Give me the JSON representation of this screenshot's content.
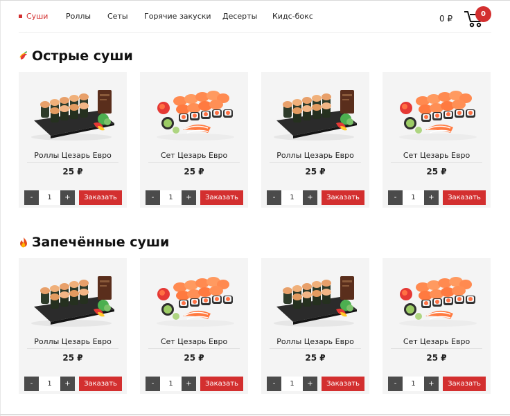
{
  "nav": {
    "items": [
      {
        "label": "Суши",
        "active": true
      },
      {
        "label": "Роллы",
        "active": false
      },
      {
        "label": "Сеты",
        "active": false
      },
      {
        "label": "Горячие закуски",
        "active": false
      },
      {
        "label": "Десерты",
        "active": false
      },
      {
        "label": "Кидс-бокс",
        "active": false
      }
    ]
  },
  "cart": {
    "total": "0 ₽",
    "count": "0",
    "icon": "cart-icon"
  },
  "sections": [
    {
      "title": "Острые суши",
      "icon": "chili-icon",
      "products": [
        {
          "name": "Роллы Цезарь Евро",
          "price": "25 ₽",
          "qty": "1",
          "image": "gunkan-board-image"
        },
        {
          "name": "Сет Цезарь Евро",
          "price": "25 ₽",
          "qty": "1",
          "image": "sushi-set-image"
        },
        {
          "name": "Роллы Цезарь Евро",
          "price": "25 ₽",
          "qty": "1",
          "image": "gunkan-board-image"
        },
        {
          "name": "Сет Цезарь Евро",
          "price": "25 ₽",
          "qty": "1",
          "image": "sushi-set-image"
        }
      ]
    },
    {
      "title": "Запечённые суши",
      "icon": "fire-icon",
      "products": [
        {
          "name": "Роллы Цезарь Евро",
          "price": "25 ₽",
          "qty": "1",
          "image": "gunkan-board-image"
        },
        {
          "name": "Сет Цезарь Евро",
          "price": "25 ₽",
          "qty": "1",
          "image": "sushi-set-image"
        },
        {
          "name": "Роллы Цезарь Евро",
          "price": "25 ₽",
          "qty": "1",
          "image": "gunkan-board-image"
        },
        {
          "name": "Сет Цезарь Евро",
          "price": "25 ₽",
          "qty": "1",
          "image": "sushi-set-image"
        }
      ]
    }
  ],
  "labels": {
    "minus": "-",
    "plus": "+",
    "order": "Заказать"
  },
  "colors": {
    "accent": "#d32f2f",
    "card_bg": "#f4f4f4",
    "stepper": "#4b4b4b"
  }
}
